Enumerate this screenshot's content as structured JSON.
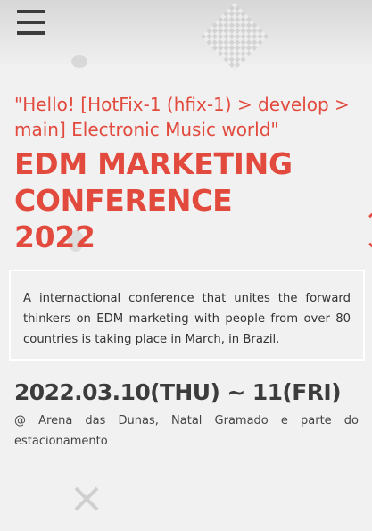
{
  "header": {
    "menu_icon": "hamburger-menu-icon"
  },
  "hero": {
    "greeting": "\"Hello! [HotFix-1 (hfix-1) > develop > main] Electronic Music world\"",
    "title_lines": [
      "EDM MARKETING",
      "CONFERENCE",
      "2022"
    ],
    "description": "A internactional conference that unites the forward thinkers on EDM marketing with people from over 80 countries is taking place in March, in Brazil.",
    "date": "2022.03.10(THU) ~ 11(FRI)",
    "venue": "@ Arena das Dunas, Natal Gramado e parte do estacionamento"
  },
  "colors": {
    "accent": "#e24a3e",
    "text_dark": "#3c3c3c",
    "background": "#f1f1f1"
  }
}
